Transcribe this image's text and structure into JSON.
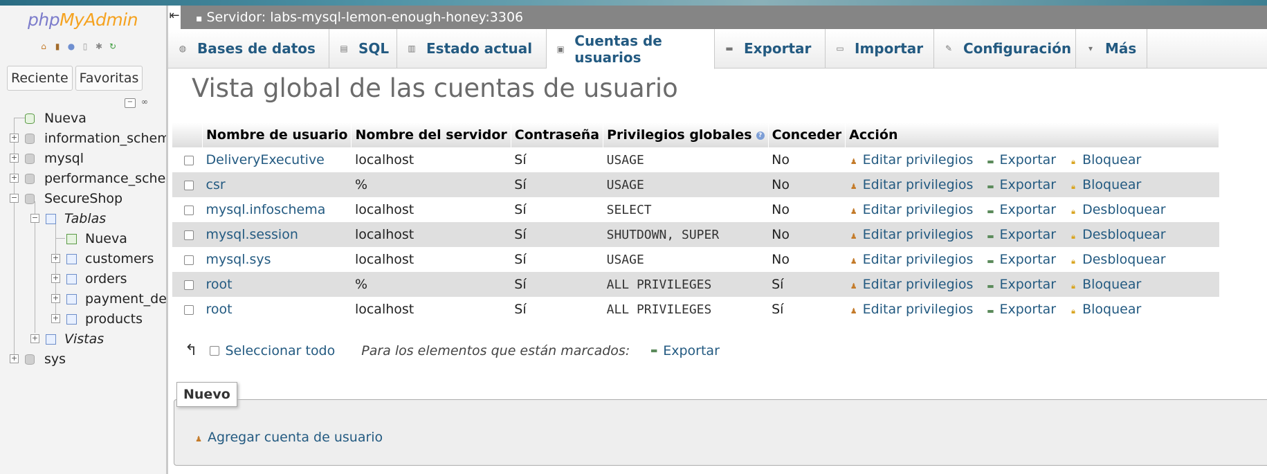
{
  "logo": {
    "php": "php",
    "my": "MyAdmin"
  },
  "nav": {
    "recent": "Reciente",
    "favorites": "Favoritas",
    "tree": [
      {
        "label": "Nueva"
      },
      {
        "label": "information_schema"
      },
      {
        "label": "mysql"
      },
      {
        "label": "performance_schema"
      },
      {
        "label": "SecureShop"
      },
      {
        "label": "Tablas"
      },
      {
        "label": "Nueva"
      },
      {
        "label": "customers"
      },
      {
        "label": "orders"
      },
      {
        "label": "payment_details"
      },
      {
        "label": "products"
      },
      {
        "label": "Vistas"
      },
      {
        "label": "sys"
      }
    ]
  },
  "server": {
    "label": "Servidor: labs-mysql-lemon-enough-honey:3306"
  },
  "menu": {
    "databases": "Bases de datos",
    "sql": "SQL",
    "status": "Estado actual",
    "accounts": "Cuentas de usuarios",
    "export": "Exportar",
    "import": "Importar",
    "settings": "Configuración",
    "more": "Más"
  },
  "page": {
    "title": "Vista global de las cuentas de usuario"
  },
  "table": {
    "headers": [
      "Nombre de usuario",
      "Nombre del servidor",
      "Contraseña",
      "Privilegios globales",
      "Conceder",
      "Acción"
    ],
    "rows": [
      {
        "user": "DeliveryExecutive",
        "host": "localhost",
        "password": "Sí",
        "privileges": "USAGE",
        "grant": "No",
        "edit": "Editar privilegios",
        "export": "Exportar",
        "lock": "Bloquear"
      },
      {
        "user": "csr",
        "host": "%",
        "password": "Sí",
        "privileges": "USAGE",
        "grant": "No",
        "edit": "Editar privilegios",
        "export": "Exportar",
        "lock": "Bloquear"
      },
      {
        "user": "mysql.infoschema",
        "host": "localhost",
        "password": "Sí",
        "privileges": "SELECT",
        "grant": "No",
        "edit": "Editar privilegios",
        "export": "Exportar",
        "lock": "Desbloquear"
      },
      {
        "user": "mysql.session",
        "host": "localhost",
        "password": "Sí",
        "privileges": "SHUTDOWN, SUPER",
        "grant": "No",
        "edit": "Editar privilegios",
        "export": "Exportar",
        "lock": "Desbloquear"
      },
      {
        "user": "mysql.sys",
        "host": "localhost",
        "password": "Sí",
        "privileges": "USAGE",
        "grant": "No",
        "edit": "Editar privilegios",
        "export": "Exportar",
        "lock": "Desbloquear"
      },
      {
        "user": "root",
        "host": "%",
        "password": "Sí",
        "privileges": "ALL PRIVILEGES",
        "grant": "Sí",
        "edit": "Editar privilegios",
        "export": "Exportar",
        "lock": "Bloquear"
      },
      {
        "user": "root",
        "host": "localhost",
        "password": "Sí",
        "privileges": "ALL PRIVILEGES",
        "grant": "Sí",
        "edit": "Editar privilegios",
        "export": "Exportar",
        "lock": "Bloquear"
      }
    ]
  },
  "footer": {
    "select_all": "Seleccionar todo",
    "with_marked": "Para los elementos que están marcados:",
    "export": "Exportar"
  },
  "new_section": {
    "legend": "Nuevo",
    "add_user": "Agregar cuenta de usuario"
  }
}
